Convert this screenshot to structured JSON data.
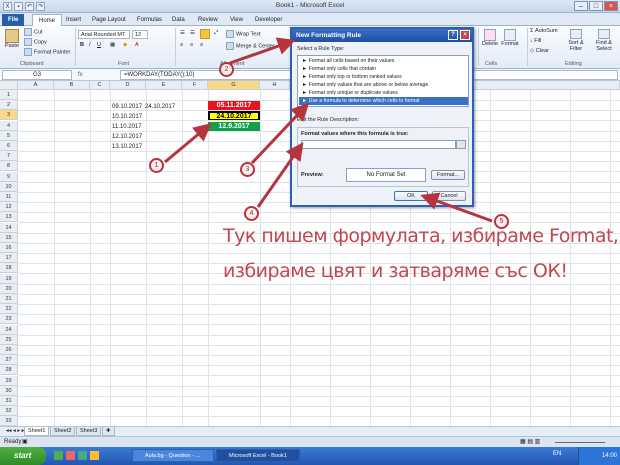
{
  "window": {
    "title": "Book1 - Microsoft Excel",
    "tabs": [
      "File",
      "Home",
      "Insert",
      "Page Layout",
      "Formulas",
      "Data",
      "Review",
      "View",
      "Developer"
    ]
  },
  "ribbon": {
    "paste": "Paste",
    "cut": "Cut",
    "copy": "Copy",
    "format_painter": "Format Painter",
    "clipboard_group": "Clipboard",
    "font_name": "Arial Rounded MT",
    "font_size": "12",
    "font_group": "Font",
    "wrap_text": "Wrap Text",
    "merge_center": "Merge & Center",
    "alignment_group": "Alignment",
    "delete": "Delete",
    "format": "Format",
    "cells_group": "Cells",
    "autosum": "AutoSum",
    "fill": "Fill",
    "clear": "Clear",
    "sort_filter": "Sort & Filter",
    "find_select": "Find & Select",
    "editing_group": "Editing"
  },
  "formula_bar": {
    "name_box": "G3",
    "fx": "fx",
    "formula": "=WORKDAY(TODAY();10)"
  },
  "grid": {
    "columns": [
      "A",
      "B",
      "C",
      "D",
      "E",
      "F",
      "G",
      "H"
    ],
    "rows": [
      "1",
      "2",
      "3",
      "4",
      "5",
      "6",
      "7",
      "8",
      "9",
      "10",
      "11",
      "12",
      "13",
      "14",
      "15",
      "16",
      "17",
      "18",
      "19",
      "20",
      "21",
      "22",
      "23",
      "24",
      "25",
      "26",
      "27",
      "28",
      "29",
      "30",
      "31",
      "32",
      "33"
    ],
    "selected_column": "G",
    "selected_row": "3",
    "d_values": [
      "09.10.2017",
      "10.10.2017",
      "11.10.2017",
      "12.10.2017",
      "13.10.2017"
    ],
    "e2": "24.10.2017",
    "g_values": [
      {
        "text": "05.11.2017",
        "bg": "#e5141e",
        "fg": "#ffffff"
      },
      {
        "text": "24.10.2017",
        "bg": "#ffff00",
        "fg": "#000000"
      },
      {
        "text": "12.9.2017",
        "bg": "#12a14a",
        "fg": "#ffffff"
      }
    ]
  },
  "sheets": [
    "Sheet1",
    "Sheet2",
    "Sheet3"
  ],
  "status": {
    "ready": "Ready"
  },
  "dialog": {
    "title": "New Formatting Rule",
    "help": "?",
    "close": "×",
    "select_rule_label": "Select a Rule Type:",
    "rule_types": [
      "► Format all cells based on their values",
      "► Format only cells that contain",
      "► Format only top or bottom ranked values",
      "► Format only values that are above or below average",
      "► Format only unique or duplicate values",
      "► Use a formula to determine which cells to format"
    ],
    "selected_rule_index": 5,
    "edit_label": "Edit the Rule Description:",
    "formula_label": "Format values where this formula is true:",
    "formula_value": "",
    "preview_label": "Preview:",
    "preview_text": "No Format Set",
    "format_button": "Format...",
    "ok": "OK",
    "cancel": "Cancel"
  },
  "annotation": {
    "line1": "Тук пишем формулата, избираме Format,",
    "line2": "избираме цвят и затваряме със ОК!",
    "markers": [
      "1",
      "2",
      "3",
      "4",
      "5"
    ]
  },
  "taskbar": {
    "start": "start",
    "tasks": [
      "Aula.bg - Question - ...",
      "Microsoft Excel - Book1"
    ],
    "lang": "EN",
    "clock": "14:00"
  },
  "colors": {
    "annotation": "#c2474e",
    "dialog_title": "#2e5fb8",
    "selection": "#3a6fc6"
  }
}
